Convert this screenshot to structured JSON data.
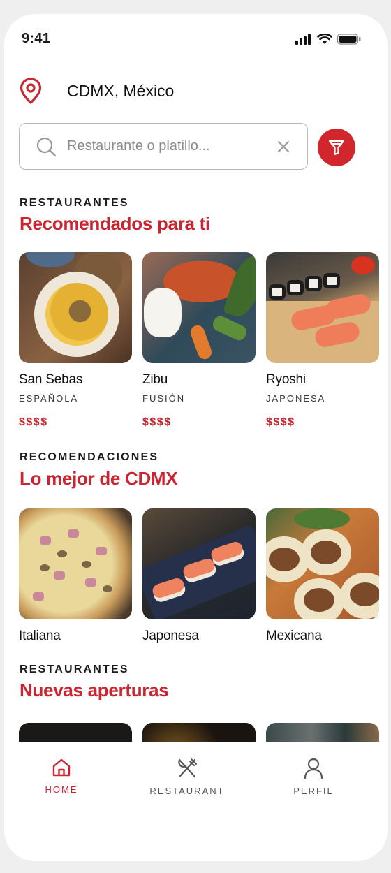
{
  "status_bar": {
    "time": "9:41",
    "icons": [
      "signal-icon",
      "wifi-icon",
      "battery-icon"
    ]
  },
  "location": {
    "icon": "map-pin-icon",
    "city": "CDMX, México"
  },
  "search": {
    "placeholder": "Restaurante o platillo...",
    "icon": "search-icon",
    "clear_icon": "close-icon",
    "filter_icon": "filter-icon"
  },
  "sections": [
    {
      "eyebrow": "RESTAURANTES",
      "title": "Recomendados para ti",
      "items": [
        {
          "name": "San Sebas",
          "cuisine": "ESPAÑOLA",
          "price": "$$$$"
        },
        {
          "name": "Zibu",
          "cuisine": "FUSIÓN",
          "price": "$$$$"
        },
        {
          "name": "Ryoshi",
          "cuisine": "JAPONESA",
          "price": "$$$$"
        }
      ]
    },
    {
      "eyebrow": "RECOMENDACIONES",
      "title": "Lo mejor de CDMX",
      "items": [
        {
          "name": "Italiana"
        },
        {
          "name": "Japonesa"
        },
        {
          "name": "Mexicana"
        }
      ]
    },
    {
      "eyebrow": "RESTAURANTES",
      "title": "Nuevas aperturas"
    }
  ],
  "bottom_nav": [
    {
      "label": "HOME",
      "icon": "home-icon",
      "active": true
    },
    {
      "label": "RESTAURANT",
      "icon": "utensils-icon",
      "active": false
    },
    {
      "label": "PERFIL",
      "icon": "user-icon",
      "active": false
    }
  ],
  "colors": {
    "accent": "#cc2530",
    "filter_button": "#d0262c",
    "text": "#1a1a1a",
    "muted": "#8b8b8b"
  }
}
